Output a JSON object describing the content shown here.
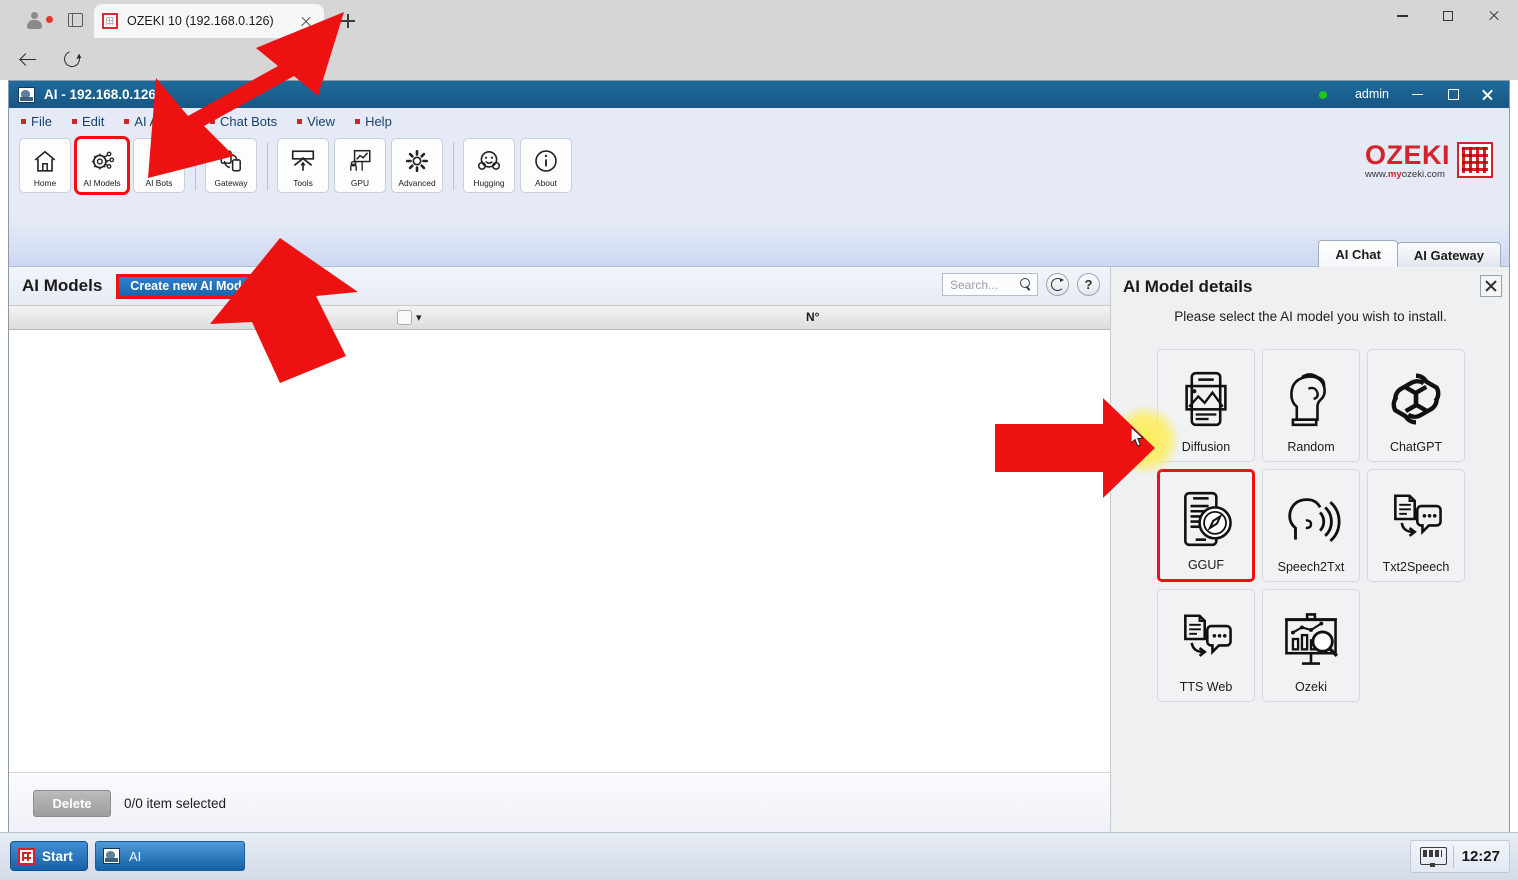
{
  "browser": {
    "tab": {
      "title": "OZEKI 10 (192.168.0.126)",
      "favicon": "ozeki-grid-favicon"
    },
    "new_tab_label": "+",
    "url": "https://192.168.0.126:9220/AI/?a=AIModels&ncrefreshCVBZRRJM=OUPU",
    "icons": {
      "back": "back-arrow-icon",
      "reload": "reload-icon",
      "lock": "lock-icon",
      "favorite": "star-icon",
      "collections": "collections-icon",
      "more": "more-options-icon",
      "copilot": "copilot-icon"
    },
    "window_controls": {
      "minimize": "minimize-icon",
      "maximize": "maximize-icon",
      "close": "close-icon"
    }
  },
  "app": {
    "title": "AI - 192.168.0.126",
    "user": "admin",
    "status_color": "#1ec81e",
    "menu": [
      {
        "label": "File"
      },
      {
        "label": "Edit"
      },
      {
        "label": "AI Agents"
      },
      {
        "label": "Chat Bots"
      },
      {
        "label": "View"
      },
      {
        "label": "Help"
      }
    ],
    "ribbon": [
      {
        "label": "Home",
        "icon": "home-icon",
        "highlighted": false
      },
      {
        "label": "AI Models",
        "icon": "ai-models-gear-icon",
        "highlighted": true
      },
      {
        "label": "AI Bots",
        "icon": "ai-bots-icon",
        "highlighted": false
      },
      {
        "label": "Gateway",
        "icon": "gateway-icon",
        "highlighted": false
      },
      {
        "label": "Tools",
        "icon": "tools-icon",
        "highlighted": false
      },
      {
        "label": "GPU",
        "icon": "gpu-chart-icon",
        "highlighted": false
      },
      {
        "label": "Advanced",
        "icon": "advanced-gear-icon",
        "highlighted": false
      },
      {
        "label": "Hugging",
        "icon": "hugging-face-icon",
        "highlighted": false
      },
      {
        "label": "About",
        "icon": "info-icon",
        "highlighted": false
      }
    ],
    "logo": {
      "word": "OZEKI",
      "url_prefix": "www.",
      "url_brand": "my",
      "url_suffix": "ozeki.com"
    },
    "tabs": [
      {
        "label": "AI Chat",
        "active": true
      },
      {
        "label": "AI Gateway",
        "active": false
      }
    ]
  },
  "left_pane": {
    "title": "AI Models",
    "create_button": "Create new AI Model",
    "search": {
      "placeholder": "Search...",
      "value": "",
      "icon": "search-icon"
    },
    "refresh_icon": "refresh-icon",
    "help_icon": "help-icon",
    "help_label": "?",
    "table": {
      "columns": [
        {
          "label": "",
          "type": "checkbox"
        },
        {
          "label": "N°"
        }
      ],
      "rows": []
    },
    "footer": {
      "delete_button": "Delete",
      "selection_status": "0/0 item selected"
    }
  },
  "right_pane": {
    "title": "AI Model details",
    "close_icon": "close-icon",
    "instruction": "Please select the AI model you wish to install.",
    "models": [
      {
        "label": "Diffusion",
        "icon": "diffusion-phone-image-icon",
        "selected": false
      },
      {
        "label": "Random",
        "icon": "random-brain-head-icon",
        "selected": false
      },
      {
        "label": "ChatGPT",
        "icon": "chatgpt-knot-icon",
        "selected": false
      },
      {
        "label": "GGUF",
        "icon": "gguf-phone-compass-icon",
        "selected": true
      },
      {
        "label": "Speech2Txt",
        "icon": "speech-to-text-head-icon",
        "selected": false
      },
      {
        "label": "Txt2Speech",
        "icon": "text-to-speech-doc-icon",
        "selected": false
      },
      {
        "label": "TTS Web",
        "icon": "tts-web-doc-bubble-icon",
        "selected": false
      },
      {
        "label": "Ozeki",
        "icon": "ozeki-chart-search-icon",
        "selected": false
      }
    ]
  },
  "taskbar": {
    "start_label": "Start",
    "start_icon": "ozeki-start-icon",
    "tasks": [
      {
        "label": "AI",
        "icon": "ozeki-app-icon",
        "active": true
      }
    ],
    "tray_icon": "display-settings-icon",
    "clock": "12:27"
  },
  "annotations": {
    "arrow_color": "#ee1111",
    "highlight_color": "#ef1111",
    "glow_color": "#ffee50",
    "arrows": [
      {
        "name": "arrow-to-ai-models-button",
        "direction": "down-left"
      },
      {
        "name": "arrow-to-create-new-ai-model-button",
        "direction": "up"
      },
      {
        "name": "arrow-to-gguf-tile",
        "direction": "right"
      }
    ]
  }
}
